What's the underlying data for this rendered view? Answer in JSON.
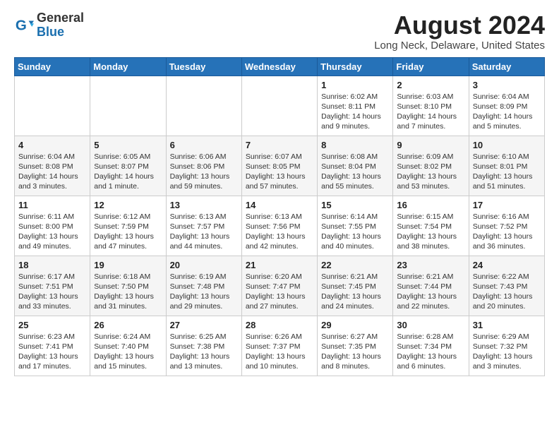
{
  "header": {
    "logo_general": "General",
    "logo_blue": "Blue",
    "month_year": "August 2024",
    "location": "Long Neck, Delaware, United States"
  },
  "days_of_week": [
    "Sunday",
    "Monday",
    "Tuesday",
    "Wednesday",
    "Thursday",
    "Friday",
    "Saturday"
  ],
  "weeks": [
    [
      {
        "day": "",
        "info": ""
      },
      {
        "day": "",
        "info": ""
      },
      {
        "day": "",
        "info": ""
      },
      {
        "day": "",
        "info": ""
      },
      {
        "day": "1",
        "info": "Sunrise: 6:02 AM\nSunset: 8:11 PM\nDaylight: 14 hours\nand 9 minutes."
      },
      {
        "day": "2",
        "info": "Sunrise: 6:03 AM\nSunset: 8:10 PM\nDaylight: 14 hours\nand 7 minutes."
      },
      {
        "day": "3",
        "info": "Sunrise: 6:04 AM\nSunset: 8:09 PM\nDaylight: 14 hours\nand 5 minutes."
      }
    ],
    [
      {
        "day": "4",
        "info": "Sunrise: 6:04 AM\nSunset: 8:08 PM\nDaylight: 14 hours\nand 3 minutes."
      },
      {
        "day": "5",
        "info": "Sunrise: 6:05 AM\nSunset: 8:07 PM\nDaylight: 14 hours\nand 1 minute."
      },
      {
        "day": "6",
        "info": "Sunrise: 6:06 AM\nSunset: 8:06 PM\nDaylight: 13 hours\nand 59 minutes."
      },
      {
        "day": "7",
        "info": "Sunrise: 6:07 AM\nSunset: 8:05 PM\nDaylight: 13 hours\nand 57 minutes."
      },
      {
        "day": "8",
        "info": "Sunrise: 6:08 AM\nSunset: 8:04 PM\nDaylight: 13 hours\nand 55 minutes."
      },
      {
        "day": "9",
        "info": "Sunrise: 6:09 AM\nSunset: 8:02 PM\nDaylight: 13 hours\nand 53 minutes."
      },
      {
        "day": "10",
        "info": "Sunrise: 6:10 AM\nSunset: 8:01 PM\nDaylight: 13 hours\nand 51 minutes."
      }
    ],
    [
      {
        "day": "11",
        "info": "Sunrise: 6:11 AM\nSunset: 8:00 PM\nDaylight: 13 hours\nand 49 minutes."
      },
      {
        "day": "12",
        "info": "Sunrise: 6:12 AM\nSunset: 7:59 PM\nDaylight: 13 hours\nand 47 minutes."
      },
      {
        "day": "13",
        "info": "Sunrise: 6:13 AM\nSunset: 7:57 PM\nDaylight: 13 hours\nand 44 minutes."
      },
      {
        "day": "14",
        "info": "Sunrise: 6:13 AM\nSunset: 7:56 PM\nDaylight: 13 hours\nand 42 minutes."
      },
      {
        "day": "15",
        "info": "Sunrise: 6:14 AM\nSunset: 7:55 PM\nDaylight: 13 hours\nand 40 minutes."
      },
      {
        "day": "16",
        "info": "Sunrise: 6:15 AM\nSunset: 7:54 PM\nDaylight: 13 hours\nand 38 minutes."
      },
      {
        "day": "17",
        "info": "Sunrise: 6:16 AM\nSunset: 7:52 PM\nDaylight: 13 hours\nand 36 minutes."
      }
    ],
    [
      {
        "day": "18",
        "info": "Sunrise: 6:17 AM\nSunset: 7:51 PM\nDaylight: 13 hours\nand 33 minutes."
      },
      {
        "day": "19",
        "info": "Sunrise: 6:18 AM\nSunset: 7:50 PM\nDaylight: 13 hours\nand 31 minutes."
      },
      {
        "day": "20",
        "info": "Sunrise: 6:19 AM\nSunset: 7:48 PM\nDaylight: 13 hours\nand 29 minutes."
      },
      {
        "day": "21",
        "info": "Sunrise: 6:20 AM\nSunset: 7:47 PM\nDaylight: 13 hours\nand 27 minutes."
      },
      {
        "day": "22",
        "info": "Sunrise: 6:21 AM\nSunset: 7:45 PM\nDaylight: 13 hours\nand 24 minutes."
      },
      {
        "day": "23",
        "info": "Sunrise: 6:21 AM\nSunset: 7:44 PM\nDaylight: 13 hours\nand 22 minutes."
      },
      {
        "day": "24",
        "info": "Sunrise: 6:22 AM\nSunset: 7:43 PM\nDaylight: 13 hours\nand 20 minutes."
      }
    ],
    [
      {
        "day": "25",
        "info": "Sunrise: 6:23 AM\nSunset: 7:41 PM\nDaylight: 13 hours\nand 17 minutes."
      },
      {
        "day": "26",
        "info": "Sunrise: 6:24 AM\nSunset: 7:40 PM\nDaylight: 13 hours\nand 15 minutes."
      },
      {
        "day": "27",
        "info": "Sunrise: 6:25 AM\nSunset: 7:38 PM\nDaylight: 13 hours\nand 13 minutes."
      },
      {
        "day": "28",
        "info": "Sunrise: 6:26 AM\nSunset: 7:37 PM\nDaylight: 13 hours\nand 10 minutes."
      },
      {
        "day": "29",
        "info": "Sunrise: 6:27 AM\nSunset: 7:35 PM\nDaylight: 13 hours\nand 8 minutes."
      },
      {
        "day": "30",
        "info": "Sunrise: 6:28 AM\nSunset: 7:34 PM\nDaylight: 13 hours\nand 6 minutes."
      },
      {
        "day": "31",
        "info": "Sunrise: 6:29 AM\nSunset: 7:32 PM\nDaylight: 13 hours\nand 3 minutes."
      }
    ]
  ]
}
